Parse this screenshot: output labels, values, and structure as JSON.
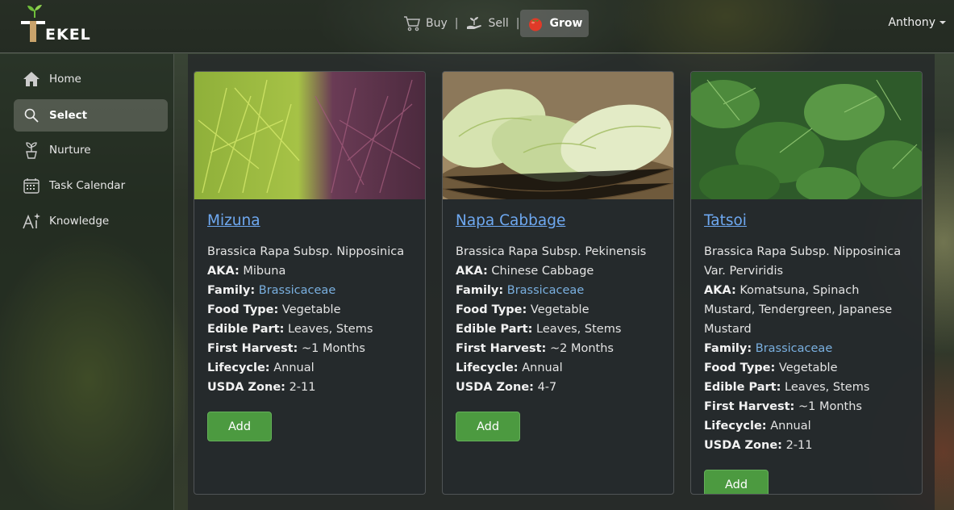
{
  "brand": {
    "logo_text": "EKEL"
  },
  "topnav": {
    "links": [
      {
        "label": "Buy",
        "icon": "cart-icon"
      },
      {
        "label": "Sell",
        "icon": "hand-plant-icon"
      },
      {
        "label": "Grow",
        "icon": "tomato-icon",
        "active": true
      }
    ],
    "separator": "|"
  },
  "user": {
    "name": "Anthony"
  },
  "sidebar": {
    "items": [
      {
        "label": "Home",
        "icon": "home-icon"
      },
      {
        "label": "Select",
        "icon": "search-icon",
        "active": true
      },
      {
        "label": "Nurture",
        "icon": "seedling-icon"
      },
      {
        "label": "Task Calendar",
        "icon": "calendar-icon"
      },
      {
        "label": "Knowledge",
        "icon": "ai-sparkle-icon"
      }
    ]
  },
  "cards": [
    {
      "title": "Mizuna",
      "scientific_name": "Brassica Rapa Subsp. Nipposinica",
      "aka_label": "AKA:",
      "aka": "Mibuna",
      "family_label": "Family:",
      "family": "Brassicaceae",
      "food_type_label": "Food Type:",
      "food_type": "Vegetable",
      "edible_part_label": "Edible Part:",
      "edible_part": "Leaves, Stems",
      "first_harvest_label": "First Harvest:",
      "first_harvest": "~1 Months",
      "lifecycle_label": "Lifecycle:",
      "lifecycle": "Annual",
      "usda_zone_label": "USDA Zone:",
      "usda_zone": "2-11",
      "button": "Add"
    },
    {
      "title": "Napa Cabbage",
      "scientific_name": "Brassica Rapa Subsp. Pekinensis",
      "aka_label": "AKA:",
      "aka": "Chinese Cabbage",
      "family_label": "Family:",
      "family": "Brassicaceae",
      "food_type_label": "Food Type:",
      "food_type": "Vegetable",
      "edible_part_label": "Edible Part:",
      "edible_part": "Leaves, Stems",
      "first_harvest_label": "First Harvest:",
      "first_harvest": "~2 Months",
      "lifecycle_label": "Lifecycle:",
      "lifecycle": "Annual",
      "usda_zone_label": "USDA Zone:",
      "usda_zone": "4-7",
      "button": "Add"
    },
    {
      "title": "Tatsoi",
      "scientific_name": "Brassica Rapa Subsp. Nipposinica Var. Perviridis",
      "aka_label": "AKA:",
      "aka": "Komatsuna, Spinach Mustard, Tendergreen, Japanese Mustard",
      "family_label": "Family:",
      "family": "Brassicaceae",
      "food_type_label": "Food Type:",
      "food_type": "Vegetable",
      "edible_part_label": "Edible Part:",
      "edible_part": "Leaves, Stems",
      "first_harvest_label": "First Harvest:",
      "first_harvest": "~1 Months",
      "lifecycle_label": "Lifecycle:",
      "lifecycle": "Annual",
      "usda_zone_label": "USDA Zone:",
      "usda_zone": "2-11",
      "button": "Add"
    }
  ],
  "colors": {
    "link": "#6ea8f0",
    "family_link": "#7ab0e0",
    "add_button": "#4c9a40",
    "active_nav": "#787878"
  }
}
